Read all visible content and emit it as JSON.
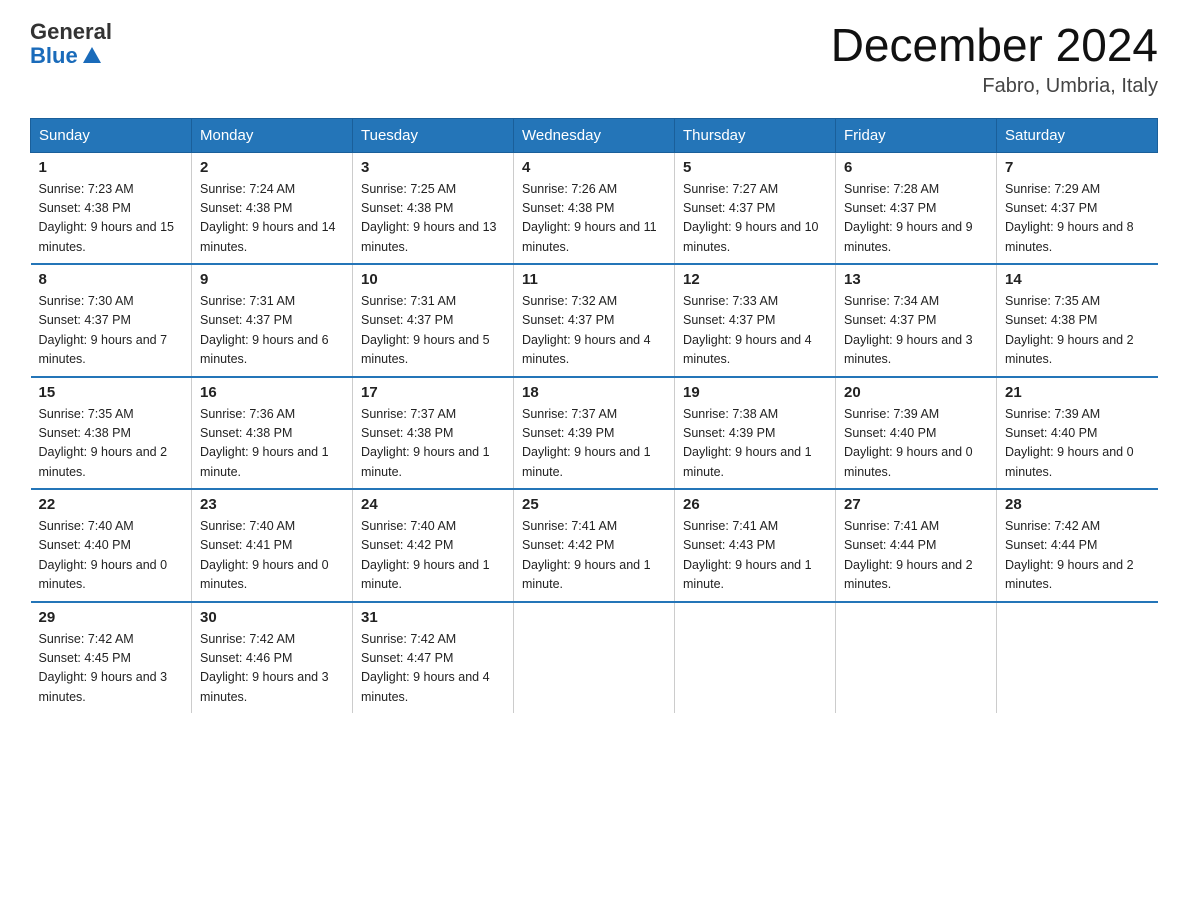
{
  "header": {
    "logo_general": "General",
    "logo_blue": "Blue",
    "month_title": "December 2024",
    "location": "Fabro, Umbria, Italy"
  },
  "weekdays": [
    "Sunday",
    "Monday",
    "Tuesday",
    "Wednesday",
    "Thursday",
    "Friday",
    "Saturday"
  ],
  "weeks": [
    [
      {
        "day": "1",
        "sunrise": "Sunrise: 7:23 AM",
        "sunset": "Sunset: 4:38 PM",
        "daylight": "Daylight: 9 hours and 15 minutes."
      },
      {
        "day": "2",
        "sunrise": "Sunrise: 7:24 AM",
        "sunset": "Sunset: 4:38 PM",
        "daylight": "Daylight: 9 hours and 14 minutes."
      },
      {
        "day": "3",
        "sunrise": "Sunrise: 7:25 AM",
        "sunset": "Sunset: 4:38 PM",
        "daylight": "Daylight: 9 hours and 13 minutes."
      },
      {
        "day": "4",
        "sunrise": "Sunrise: 7:26 AM",
        "sunset": "Sunset: 4:38 PM",
        "daylight": "Daylight: 9 hours and 11 minutes."
      },
      {
        "day": "5",
        "sunrise": "Sunrise: 7:27 AM",
        "sunset": "Sunset: 4:37 PM",
        "daylight": "Daylight: 9 hours and 10 minutes."
      },
      {
        "day": "6",
        "sunrise": "Sunrise: 7:28 AM",
        "sunset": "Sunset: 4:37 PM",
        "daylight": "Daylight: 9 hours and 9 minutes."
      },
      {
        "day": "7",
        "sunrise": "Sunrise: 7:29 AM",
        "sunset": "Sunset: 4:37 PM",
        "daylight": "Daylight: 9 hours and 8 minutes."
      }
    ],
    [
      {
        "day": "8",
        "sunrise": "Sunrise: 7:30 AM",
        "sunset": "Sunset: 4:37 PM",
        "daylight": "Daylight: 9 hours and 7 minutes."
      },
      {
        "day": "9",
        "sunrise": "Sunrise: 7:31 AM",
        "sunset": "Sunset: 4:37 PM",
        "daylight": "Daylight: 9 hours and 6 minutes."
      },
      {
        "day": "10",
        "sunrise": "Sunrise: 7:31 AM",
        "sunset": "Sunset: 4:37 PM",
        "daylight": "Daylight: 9 hours and 5 minutes."
      },
      {
        "day": "11",
        "sunrise": "Sunrise: 7:32 AM",
        "sunset": "Sunset: 4:37 PM",
        "daylight": "Daylight: 9 hours and 4 minutes."
      },
      {
        "day": "12",
        "sunrise": "Sunrise: 7:33 AM",
        "sunset": "Sunset: 4:37 PM",
        "daylight": "Daylight: 9 hours and 4 minutes."
      },
      {
        "day": "13",
        "sunrise": "Sunrise: 7:34 AM",
        "sunset": "Sunset: 4:37 PM",
        "daylight": "Daylight: 9 hours and 3 minutes."
      },
      {
        "day": "14",
        "sunrise": "Sunrise: 7:35 AM",
        "sunset": "Sunset: 4:38 PM",
        "daylight": "Daylight: 9 hours and 2 minutes."
      }
    ],
    [
      {
        "day": "15",
        "sunrise": "Sunrise: 7:35 AM",
        "sunset": "Sunset: 4:38 PM",
        "daylight": "Daylight: 9 hours and 2 minutes."
      },
      {
        "day": "16",
        "sunrise": "Sunrise: 7:36 AM",
        "sunset": "Sunset: 4:38 PM",
        "daylight": "Daylight: 9 hours and 1 minute."
      },
      {
        "day": "17",
        "sunrise": "Sunrise: 7:37 AM",
        "sunset": "Sunset: 4:38 PM",
        "daylight": "Daylight: 9 hours and 1 minute."
      },
      {
        "day": "18",
        "sunrise": "Sunrise: 7:37 AM",
        "sunset": "Sunset: 4:39 PM",
        "daylight": "Daylight: 9 hours and 1 minute."
      },
      {
        "day": "19",
        "sunrise": "Sunrise: 7:38 AM",
        "sunset": "Sunset: 4:39 PM",
        "daylight": "Daylight: 9 hours and 1 minute."
      },
      {
        "day": "20",
        "sunrise": "Sunrise: 7:39 AM",
        "sunset": "Sunset: 4:40 PM",
        "daylight": "Daylight: 9 hours and 0 minutes."
      },
      {
        "day": "21",
        "sunrise": "Sunrise: 7:39 AM",
        "sunset": "Sunset: 4:40 PM",
        "daylight": "Daylight: 9 hours and 0 minutes."
      }
    ],
    [
      {
        "day": "22",
        "sunrise": "Sunrise: 7:40 AM",
        "sunset": "Sunset: 4:40 PM",
        "daylight": "Daylight: 9 hours and 0 minutes."
      },
      {
        "day": "23",
        "sunrise": "Sunrise: 7:40 AM",
        "sunset": "Sunset: 4:41 PM",
        "daylight": "Daylight: 9 hours and 0 minutes."
      },
      {
        "day": "24",
        "sunrise": "Sunrise: 7:40 AM",
        "sunset": "Sunset: 4:42 PM",
        "daylight": "Daylight: 9 hours and 1 minute."
      },
      {
        "day": "25",
        "sunrise": "Sunrise: 7:41 AM",
        "sunset": "Sunset: 4:42 PM",
        "daylight": "Daylight: 9 hours and 1 minute."
      },
      {
        "day": "26",
        "sunrise": "Sunrise: 7:41 AM",
        "sunset": "Sunset: 4:43 PM",
        "daylight": "Daylight: 9 hours and 1 minute."
      },
      {
        "day": "27",
        "sunrise": "Sunrise: 7:41 AM",
        "sunset": "Sunset: 4:44 PM",
        "daylight": "Daylight: 9 hours and 2 minutes."
      },
      {
        "day": "28",
        "sunrise": "Sunrise: 7:42 AM",
        "sunset": "Sunset: 4:44 PM",
        "daylight": "Daylight: 9 hours and 2 minutes."
      }
    ],
    [
      {
        "day": "29",
        "sunrise": "Sunrise: 7:42 AM",
        "sunset": "Sunset: 4:45 PM",
        "daylight": "Daylight: 9 hours and 3 minutes."
      },
      {
        "day": "30",
        "sunrise": "Sunrise: 7:42 AM",
        "sunset": "Sunset: 4:46 PM",
        "daylight": "Daylight: 9 hours and 3 minutes."
      },
      {
        "day": "31",
        "sunrise": "Sunrise: 7:42 AM",
        "sunset": "Sunset: 4:47 PM",
        "daylight": "Daylight: 9 hours and 4 minutes."
      },
      {
        "day": "",
        "sunrise": "",
        "sunset": "",
        "daylight": ""
      },
      {
        "day": "",
        "sunrise": "",
        "sunset": "",
        "daylight": ""
      },
      {
        "day": "",
        "sunrise": "",
        "sunset": "",
        "daylight": ""
      },
      {
        "day": "",
        "sunrise": "",
        "sunset": "",
        "daylight": ""
      }
    ]
  ]
}
